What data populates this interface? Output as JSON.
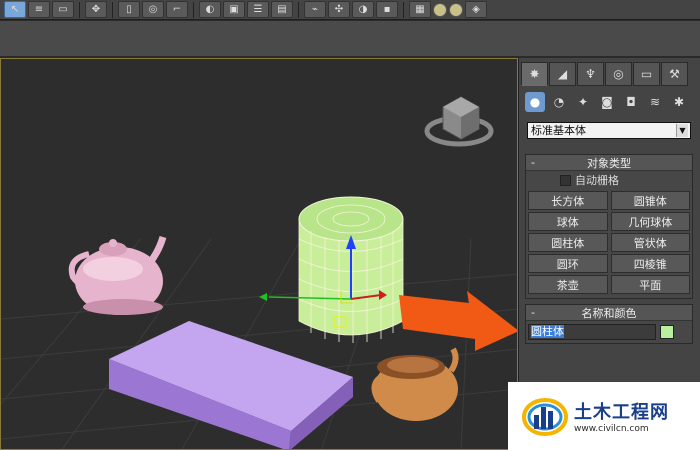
{
  "panel": {
    "dropdown_value": "标准基本体",
    "object_type": {
      "title": "对象类型",
      "toggle": "-",
      "autogrid_label": "自动栅格",
      "buttons": [
        "长方体",
        "圆锥体",
        "球体",
        "几何球体",
        "圆柱体",
        "管状体",
        "圆环",
        "四棱锥",
        "茶壶",
        "平面"
      ]
    },
    "name_color": {
      "title": "名称和颜色",
      "toggle": "-",
      "name_value": "圆柱体",
      "swatch_color": "#b8f0a0"
    }
  },
  "colors": {
    "selection_arrow": "#f05a14",
    "cylinder": "#c8ee9a",
    "box": "#b08ee0",
    "teapot_pink": "#e6b4cc",
    "teapot_orange": "#d08a4a"
  },
  "watermark": {
    "title": "土木工程网",
    "url": "www.civilcn.com"
  }
}
